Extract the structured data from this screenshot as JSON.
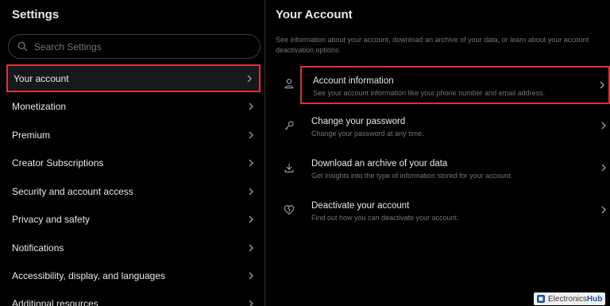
{
  "settings": {
    "title": "Settings",
    "search_placeholder": "Search Settings",
    "items": [
      {
        "label": "Your account"
      },
      {
        "label": "Monetization"
      },
      {
        "label": "Premium"
      },
      {
        "label": "Creator Subscriptions"
      },
      {
        "label": "Security and account access"
      },
      {
        "label": "Privacy and safety"
      },
      {
        "label": "Notifications"
      },
      {
        "label": "Accessibility, display, and languages"
      },
      {
        "label": "Additional resources"
      }
    ]
  },
  "account": {
    "title": "Your Account",
    "description": "See information about your account, download an archive of your data, or learn about your account deactivation options",
    "items": [
      {
        "title": "Account information",
        "subtitle": "See your account information like your phone number and email address.",
        "icon": "person-icon"
      },
      {
        "title": "Change your password",
        "subtitle": "Change your password at any time.",
        "icon": "key-icon"
      },
      {
        "title": "Download an archive of your data",
        "subtitle": "Get insights into the type of information stored for your account.",
        "icon": "download-icon"
      },
      {
        "title": "Deactivate your account",
        "subtitle": "Find out how you can deactivate your account.",
        "icon": "broken-heart-icon"
      }
    ]
  },
  "watermark": {
    "prefix": "Electronics",
    "suffix": "Hub"
  },
  "colors": {
    "highlight": "#e0303a",
    "background": "#000000",
    "muted_text": "#71767b"
  }
}
